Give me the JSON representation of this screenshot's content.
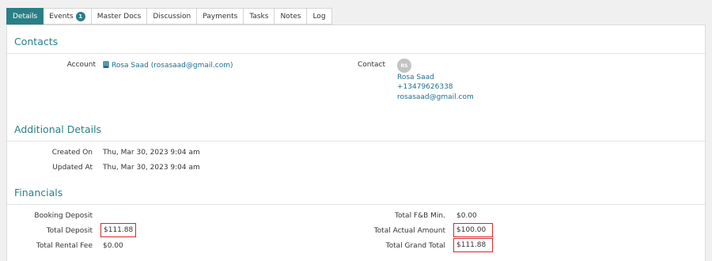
{
  "tabs": [
    {
      "label": "Details",
      "active": true
    },
    {
      "label": "Events",
      "badge": "1"
    },
    {
      "label": "Master Docs"
    },
    {
      "label": "Discussion"
    },
    {
      "label": "Payments"
    },
    {
      "label": "Tasks"
    },
    {
      "label": "Notes"
    },
    {
      "label": "Log"
    }
  ],
  "contacts": {
    "title": "Contacts",
    "account_label": "Account",
    "account_value": "Rosa Saad (rosasaad@gmail.com)",
    "contact_label": "Contact",
    "avatar_initials": "RS",
    "contact_name": "Rosa Saad",
    "contact_phone": "+13479626338",
    "contact_email": "rosasaad@gmail.com"
  },
  "additional": {
    "title": "Additional Details",
    "created_label": "Created On",
    "created_value": "Thu, Mar 30, 2023 9:04 am",
    "updated_label": "Updated At",
    "updated_value": "Thu, Mar 30, 2023 9:04 am"
  },
  "financials": {
    "title": "Financials",
    "booking_deposit_label": "Booking Deposit",
    "booking_deposit_value": "",
    "total_deposit_label": "Total Deposit",
    "total_deposit_value": "$111.88",
    "total_rental_fee_label": "Total Rental Fee",
    "total_rental_fee_value": "$0.00",
    "fb_min_label": "Total F&B Min.",
    "fb_min_value": "$0.00",
    "actual_amount_label": "Total Actual Amount",
    "actual_amount_value": "$100.00",
    "grand_total_label": "Total Grand Total",
    "grand_total_value": "$111.88"
  },
  "colors": {
    "accent": "#2a7f86",
    "link": "#1f6f8b",
    "highlight_box": "#d9262b"
  }
}
